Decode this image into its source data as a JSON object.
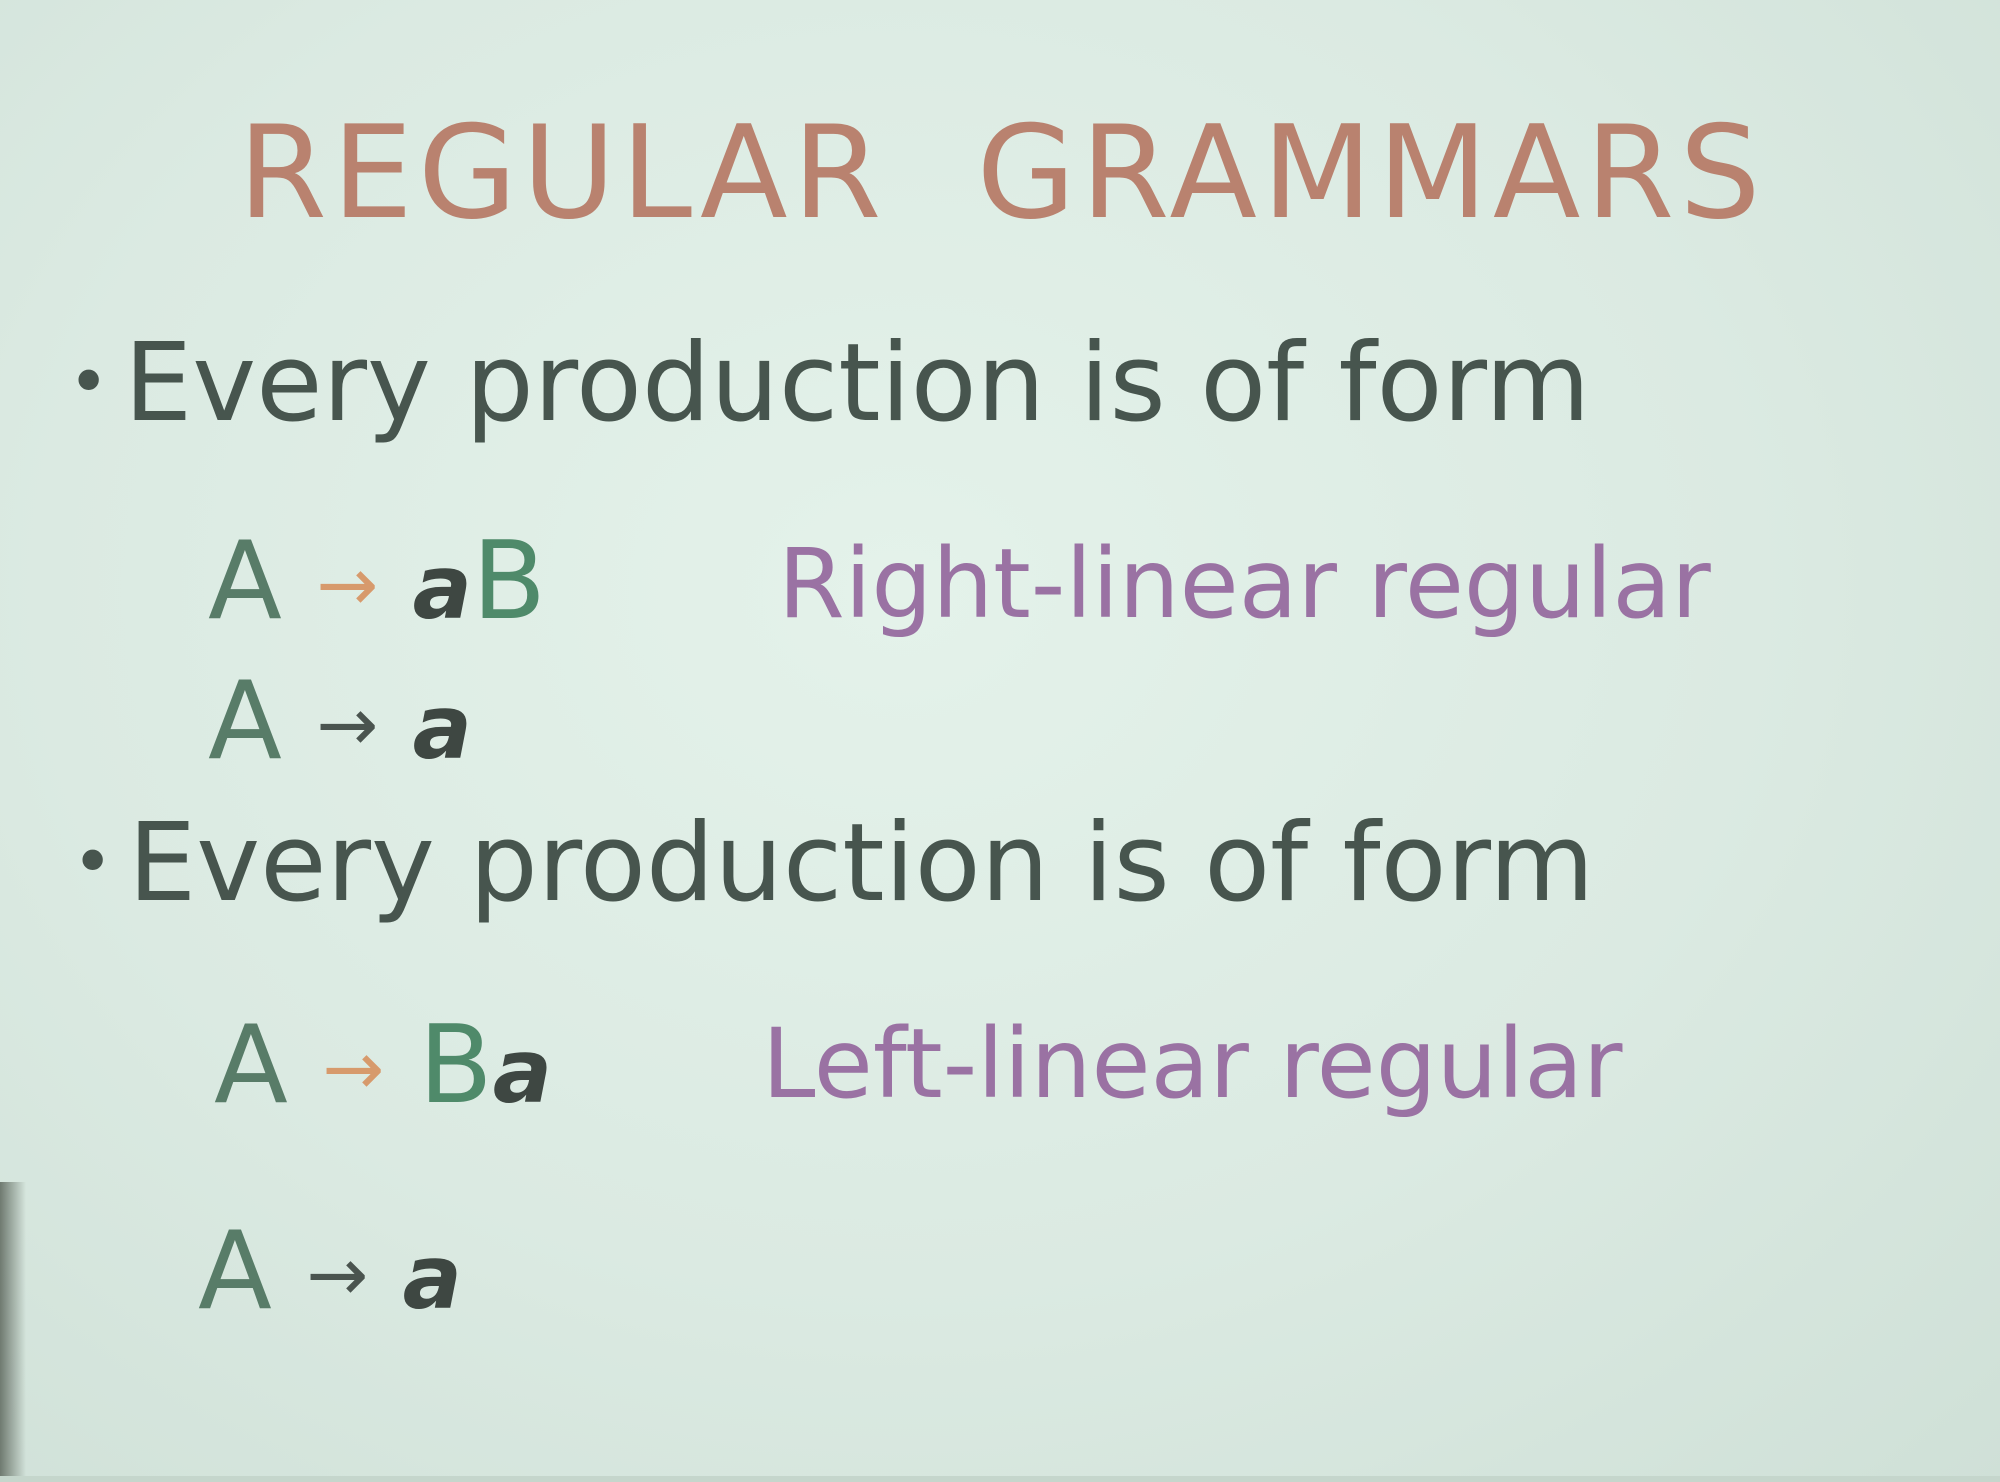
{
  "slide": {
    "title_word1": "REGULAR",
    "title_word2": "GRAMMARS",
    "bullet1": "Every production is of form",
    "rule1_lhs": "A",
    "rule1_arrow": "→",
    "rule1_terminal": "a",
    "rule1_nonterminal": "B",
    "rule1_label": "Right-linear regular",
    "rule2_lhs": "A",
    "rule2_arrow": "→",
    "rule2_terminal": "a",
    "bullet2": "Every production is of form",
    "rule3_lhs": "A",
    "rule3_arrow": "→",
    "rule3_nonterminal": "B",
    "rule3_terminal": "a",
    "rule3_label": "Left-linear regular",
    "rule4_lhs": "A",
    "rule4_arrow": "→",
    "rule4_terminal": "a"
  },
  "colors": {
    "background": "#dcebe2",
    "title": "#b9826f",
    "bullet_text": "#47554e",
    "label": "#9a72a3",
    "arrow_orange": "#d79a6c",
    "nonterminal": "#4f8a6a"
  }
}
